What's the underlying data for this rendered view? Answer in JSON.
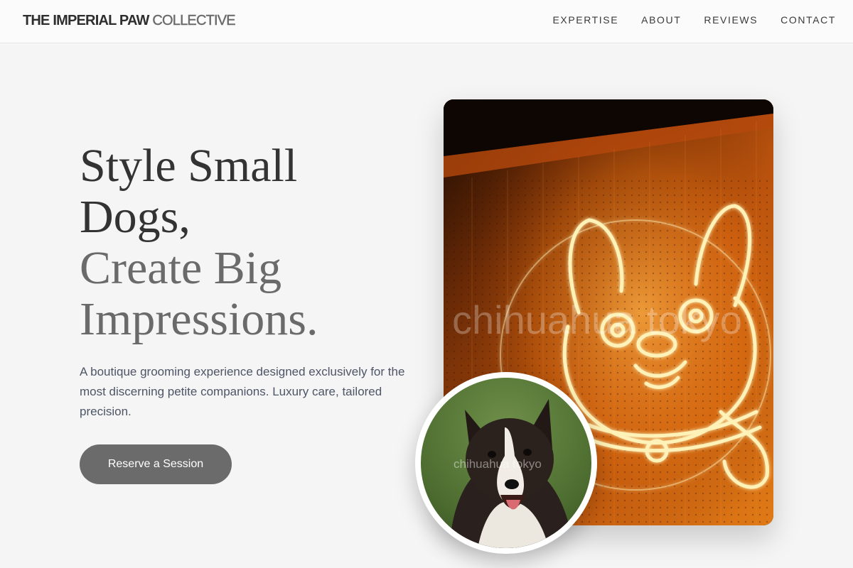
{
  "brand": {
    "name_bold": "THE IMPERIAL PAW",
    "name_light": "COLLECTIVE"
  },
  "nav": {
    "items": [
      "EXPERTISE",
      "ABOUT",
      "REVIEWS",
      "CONTACT"
    ]
  },
  "hero": {
    "title_lines": [
      "Style Small",
      "Dogs,",
      "Create Big",
      "Impressions."
    ],
    "description": "A boutique grooming experience designed exclusively for the most discerning petite companions. Luxury care, tailored precision.",
    "cta_label": "Reserve a Session"
  },
  "images": {
    "main": {
      "subject": "neon-chihuahua-sign",
      "watermark": "chihuahua tokyo"
    },
    "inset": {
      "subject": "border-collie-portrait",
      "watermark": "chihuahua tokyo"
    }
  },
  "colors": {
    "background": "#f5f5f5",
    "text_dark": "#333333",
    "text_muted": "#6a6a6a",
    "button": "#6b6b6b",
    "neon": "#ffe9a0"
  }
}
